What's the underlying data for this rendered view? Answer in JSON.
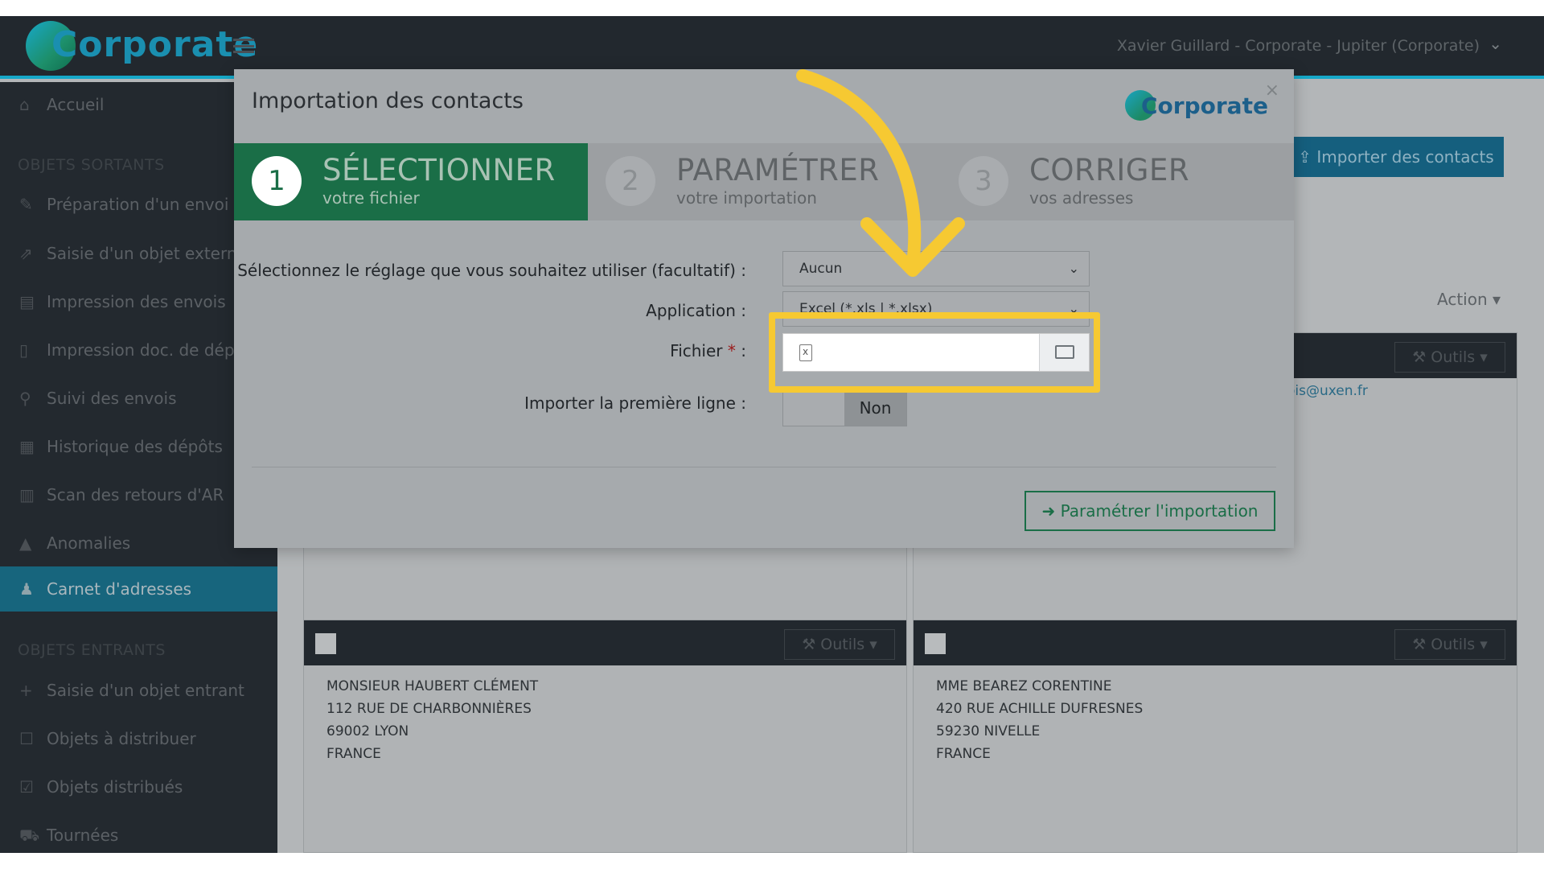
{
  "app": {
    "logo_text": "Corporate",
    "user": "Xavier Guillard - Corporate - Jupiter (Corporate)",
    "colors": {
      "accent": "#17a8c9",
      "success": "#1a6e47",
      "highlight": "#f6c932"
    }
  },
  "sidebar": {
    "items": [
      {
        "label": "Accueil",
        "icon": "home-icon"
      },
      {
        "label": "Préparation d'un envoi",
        "icon": "pencil-icon"
      },
      {
        "label": "Saisie d'un objet externe",
        "icon": "external-link-icon"
      },
      {
        "label": "Impression des envois",
        "icon": "printer-icon"
      },
      {
        "label": "Impression doc. de dépôt",
        "icon": "document-icon"
      },
      {
        "label": "Suivi des envois",
        "icon": "search-icon"
      },
      {
        "label": "Historique des dépôts",
        "icon": "calendar-icon"
      },
      {
        "label": "Scan des retours d'AR",
        "icon": "barcode-icon"
      },
      {
        "label": "Anomalies",
        "icon": "warning-icon"
      },
      {
        "label": "Carnet d'adresses",
        "icon": "users-icon"
      },
      {
        "label": "Saisie d'un objet entrant",
        "icon": "plus-icon"
      },
      {
        "label": "Objets à distribuer",
        "icon": "square-icon"
      },
      {
        "label": "Objets distribués",
        "icon": "check-square-icon"
      },
      {
        "label": "Tournées",
        "icon": "cart-icon"
      }
    ],
    "section_out": "OBJETS SORTANTS",
    "section_in": "OBJETS ENTRANTS"
  },
  "main": {
    "import_button": "Importer des contacts",
    "action_label": "Action",
    "email_fragment": "ois@uxen.fr",
    "tools_label": "Outils",
    "cards": [
      {
        "lines": [
          "MONSIEUR HAUBERT CLÉMENT",
          "112 RUE DE CHARBONNIÈRES",
          "69002 LYON",
          "FRANCE"
        ]
      },
      {
        "lines": [
          "MME BEAREZ CORENTINE",
          "420 RUE ACHILLE DUFRESNES",
          "59230 NIVELLE",
          "FRANCE"
        ]
      }
    ]
  },
  "modal": {
    "title": "Importation des contacts",
    "logo_text": "Corporate",
    "close": "×",
    "steps": [
      {
        "num": "1",
        "title": "SÉLECTIONNER",
        "sub": "votre fichier",
        "active": true
      },
      {
        "num": "2",
        "title": "PARAMÉTRER",
        "sub": "votre importation",
        "active": false
      },
      {
        "num": "3",
        "title": "CORRIGER",
        "sub": "vos adresses",
        "active": false
      }
    ],
    "fields": {
      "setting_label": "Sélectionnez le réglage que vous souhaitez utiliser (facultatif) :",
      "setting_value": "Aucun",
      "application_label": "Application :",
      "application_value": "Excel (*.xls | *.xlsx)",
      "file_label": "Fichier",
      "file_req": "*",
      "file_colon": ":",
      "first_line_label": "Importer la première ligne :",
      "first_line_value": "Non"
    },
    "next_button": "Paramétrer l'importation"
  }
}
